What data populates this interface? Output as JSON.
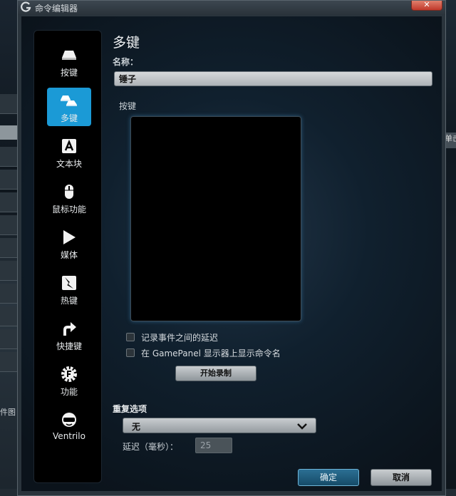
{
  "window": {
    "title": "命令编辑器",
    "close_label": "✕"
  },
  "background": {
    "left_label": "件图",
    "right_button_label": "单击"
  },
  "sidebar": {
    "items": [
      {
        "label": "按键",
        "icon": "keycap-icon",
        "active": false
      },
      {
        "label": "多键",
        "icon": "multi-key-icon",
        "active": true
      },
      {
        "label": "文本块",
        "icon": "text-block-icon",
        "active": false
      },
      {
        "label": "鼠标功能",
        "icon": "mouse-icon",
        "active": false
      },
      {
        "label": "媒体",
        "icon": "play-icon",
        "active": false
      },
      {
        "label": "热键",
        "icon": "hotkey-icon",
        "active": false
      },
      {
        "label": "快捷键",
        "icon": "shortcut-arrow-icon",
        "active": false
      },
      {
        "label": "功能",
        "icon": "function-gear-icon",
        "active": false
      },
      {
        "label": "Ventrilo",
        "icon": "headset-icon",
        "active": false
      }
    ]
  },
  "main": {
    "title": "多键",
    "name_label": "名称：",
    "name_value": "锤子",
    "keys_label": "按键",
    "options": {
      "record_delays": "记录事件之间的延迟",
      "show_name": "在 GamePanel 显示器上显示命令名"
    },
    "record_button": "开始录制",
    "repeat_label": "重复选项",
    "repeat_value": "无",
    "delay_label": "延迟（毫秒）：",
    "delay_value": "25",
    "ok_button": "确定",
    "cancel_button": "取消"
  },
  "colors": {
    "accent": "#1b9ad6",
    "ok_border": "#6fb5d8"
  }
}
